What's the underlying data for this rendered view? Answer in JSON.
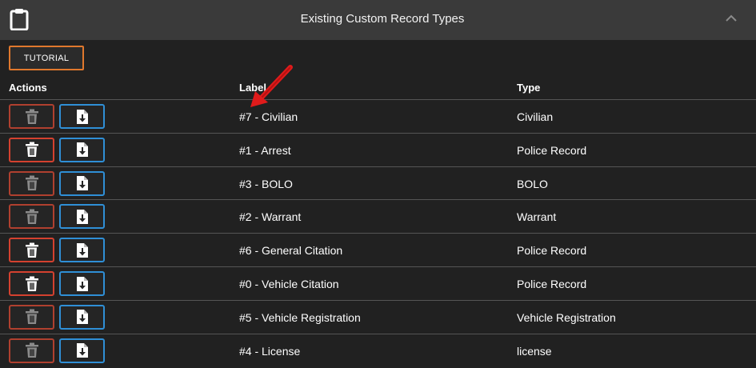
{
  "header": {
    "title": "Existing Custom Record Types",
    "icon": "clipboard-icon",
    "collapse_icon": "chevron-up-icon"
  },
  "tutorial_label": "TUTORIAL",
  "columns": {
    "actions": "Actions",
    "label": "Label",
    "type": "Type"
  },
  "rows": [
    {
      "label": "#7 - Civilian",
      "type": "Civilian",
      "delete_enabled": false
    },
    {
      "label": "#1 - Arrest",
      "type": "Police Record",
      "delete_enabled": true
    },
    {
      "label": "#3 - BOLO",
      "type": "BOLO",
      "delete_enabled": false
    },
    {
      "label": "#2 - Warrant",
      "type": "Warrant",
      "delete_enabled": false
    },
    {
      "label": "#6 - General Citation",
      "type": "Police Record",
      "delete_enabled": true
    },
    {
      "label": "#0 - Vehicle Citation",
      "type": "Police Record",
      "delete_enabled": true
    },
    {
      "label": "#5 - Vehicle Registration",
      "type": "Vehicle Registration",
      "delete_enabled": false
    },
    {
      "label": "#4 - License",
      "type": "license",
      "delete_enabled": false
    }
  ],
  "colors": {
    "delete_border": "#d4412f",
    "download_border": "#2f8fd6",
    "tutorial_border": "#e0782d",
    "annotation_arrow": "#e01b1b"
  }
}
